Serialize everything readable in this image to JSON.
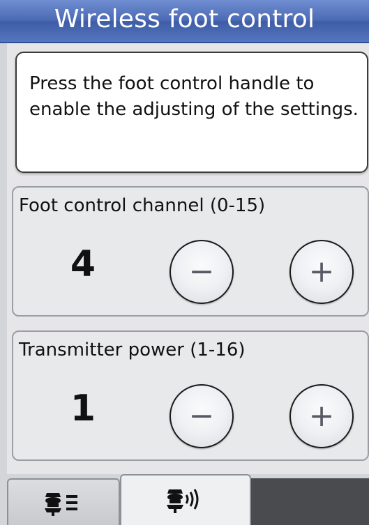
{
  "header": {
    "title": "Wireless foot control"
  },
  "message": {
    "text": "Press the foot control handle to enable the adjusting of the settings."
  },
  "channel": {
    "label": "Foot control channel (0-15)",
    "value": "4",
    "decrement_symbol": "−",
    "increment_symbol": "+"
  },
  "power": {
    "label": "Transmitter power (1-16)",
    "value": "1",
    "decrement_symbol": "−",
    "increment_symbol": "+"
  },
  "tabs": [
    {
      "icon": "foot-control-list-icon",
      "active": false
    },
    {
      "icon": "foot-control-wireless-icon",
      "active": true
    }
  ],
  "colors": {
    "title_bar": "#4c6bb5",
    "title_text": "#ffffff",
    "panel_bg": "#e8e9eb",
    "button_glyph": "#555a63"
  }
}
